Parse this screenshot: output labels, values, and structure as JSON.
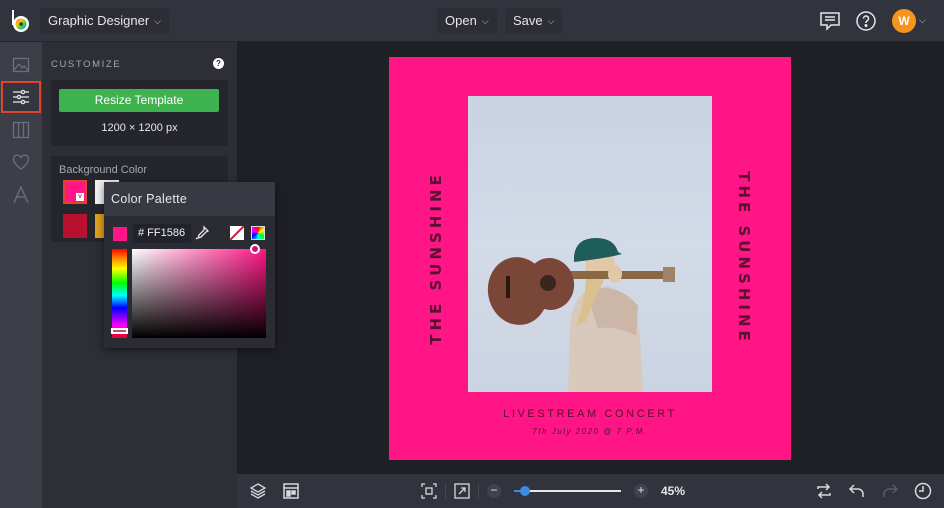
{
  "topbar": {
    "app_mode": "Graphic Designer",
    "open_label": "Open",
    "save_label": "Save",
    "avatar_initial": "W"
  },
  "rail": {
    "items": [
      "photo-manager",
      "customize",
      "layouts",
      "favorites",
      "text"
    ],
    "active": "customize"
  },
  "panel": {
    "title": "CUSTOMIZE",
    "help": "?",
    "resize_label": "Resize Template",
    "size_text": "1200 × 1200 px",
    "background_label": "Background Color",
    "swatches": [
      "#ff1586",
      "#f2f2f2",
      "#b8102f",
      "#e0a020"
    ],
    "selected_swatch": "#ff1586"
  },
  "color_palette": {
    "title": "Color Palette",
    "hex_value": "# FF1586",
    "current_color": "#ff1586"
  },
  "poster": {
    "background": "#ff1586",
    "side_text_left": "THE SUNSHINE",
    "side_text_right": "THE SUNSHINE",
    "subtitle": "LIVESTREAM CONCERT",
    "date": "7th July 2020 @ 7 P.M."
  },
  "bottombar": {
    "zoom_value_percent": 45,
    "zoom_label": "45%",
    "zoom_out": "−",
    "zoom_in": "+"
  }
}
